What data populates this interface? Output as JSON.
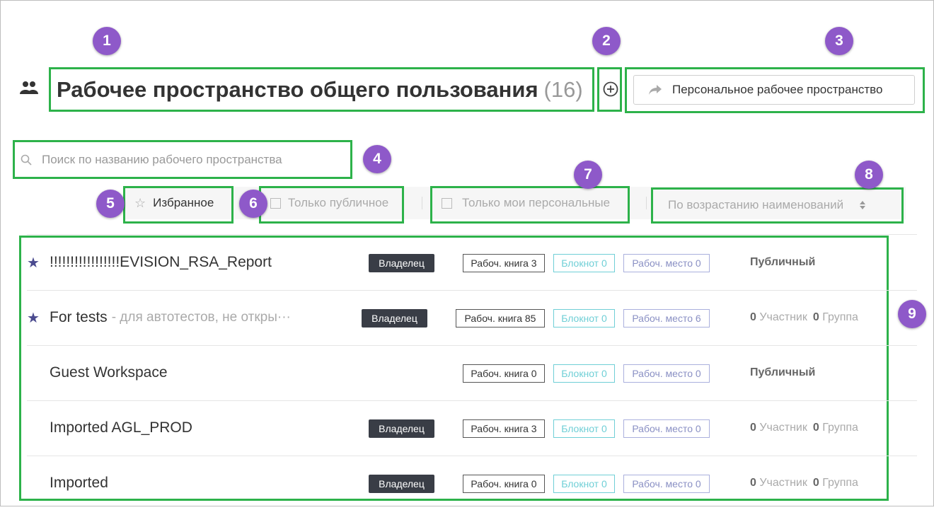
{
  "header": {
    "title": "Рабочее пространство общего пользования",
    "count": "(16)",
    "personal_button_label": "Персональное рабочее пространство"
  },
  "search": {
    "placeholder": "Поиск по названию рабочего пространства"
  },
  "filters": {
    "favorites": "Избранное",
    "only_public": "Только публичное",
    "only_my_personal": "Только мои персональные",
    "sort": "По возрастанию наименований"
  },
  "callouts": [
    "1",
    "2",
    "3",
    "4",
    "5",
    "6",
    "7",
    "8",
    "9"
  ],
  "rows": [
    {
      "starred": true,
      "name": "!!!!!!!!!!!!!!!!!EVISION_RSA_Report",
      "desc": "",
      "owner": "Владелец",
      "book": "Рабоч. книга 3",
      "note": "Блокнот 0",
      "place": "Рабоч. место 0",
      "status": "Публичный",
      "members_count": "",
      "members_label": "",
      "groups_count": "",
      "groups_label": ""
    },
    {
      "starred": true,
      "name": "For tests",
      "desc": "- для автотестов, не откры···",
      "owner": "Владелец",
      "book": "Рабоч. книга 85",
      "note": "Блокнот 0",
      "place": "Рабоч. место 6",
      "status": "",
      "members_count": "0",
      "members_label": "Участник",
      "groups_count": "0",
      "groups_label": "Группа"
    },
    {
      "starred": false,
      "name": "Guest Workspace",
      "desc": "",
      "owner": "",
      "book": "Рабоч. книга 0",
      "note": "Блокнот 0",
      "place": "Рабоч. место 0",
      "status": "Публичный",
      "members_count": "",
      "members_label": "",
      "groups_count": "",
      "groups_label": ""
    },
    {
      "starred": false,
      "name": "Imported AGL_PROD",
      "desc": "",
      "owner": "Владелец",
      "book": "Рабоч. книга 3",
      "note": "Блокнот 0",
      "place": "Рабоч. место 0",
      "status": "",
      "members_count": "0",
      "members_label": "Участник",
      "groups_count": "0",
      "groups_label": "Группа"
    },
    {
      "starred": false,
      "name": "Imported",
      "desc": "",
      "owner": "Владелец",
      "book": "Рабоч. книга 0",
      "note": "Блокнот 0",
      "place": "Рабоч. место 0",
      "status": "",
      "members_count": "0",
      "members_label": "Участник",
      "groups_count": "0",
      "groups_label": "Группа"
    }
  ],
  "colors": {
    "callout_badge": "#8e59c9",
    "highlight_box": "#2db24a",
    "owner_tag": "#393d46",
    "notebook_tag": "#6fcfd6",
    "workplace_tag": "#aab0dd",
    "star": "#4b4b8f"
  },
  "icons": {
    "workspace": "people-icon",
    "add": "plus-circle-icon",
    "personal": "share-arrow-icon",
    "search": "search-icon",
    "favorites": "star-outline-icon",
    "sort": "sort-arrows-icon",
    "row_favorite": "star-filled-icon"
  }
}
